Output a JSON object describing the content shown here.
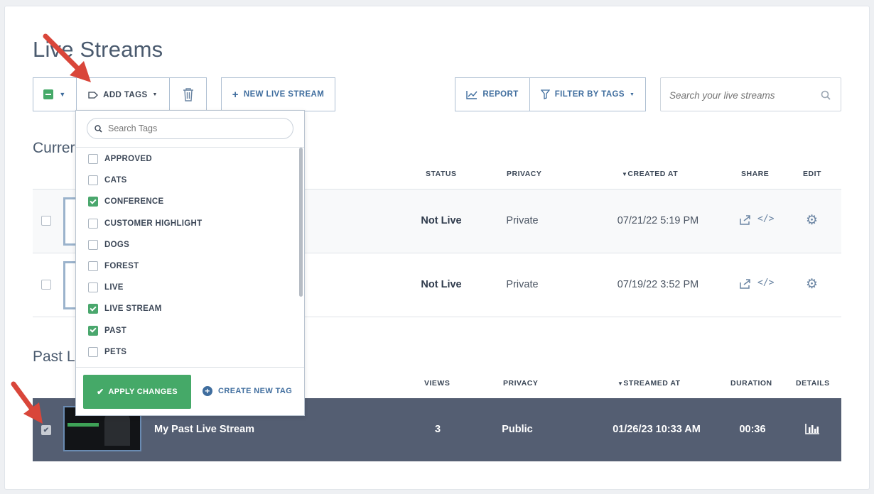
{
  "page_title": "Live Streams",
  "toolbar": {
    "add_tags": "ADD TAGS",
    "new_stream": "NEW LIVE STREAM",
    "report": "REPORT",
    "filter_tags": "FILTER BY TAGS",
    "search_placeholder": "Search your live streams"
  },
  "current": {
    "section_title": "Currer",
    "headers": {
      "status": "STATUS",
      "privacy": "PRIVACY",
      "created": "CREATED AT",
      "share": "SHARE",
      "edit": "EDIT"
    },
    "rows": [
      {
        "status": "Not Live",
        "privacy": "Private",
        "created": "07/21/22 5:19 PM"
      },
      {
        "status": "Not Live",
        "privacy": "Private",
        "created": "07/19/22 3:52 PM"
      }
    ]
  },
  "past": {
    "section_title": "Past Li",
    "headers": {
      "views": "VIEWS",
      "privacy": "PRIVACY",
      "streamed": "STREAMED AT",
      "duration": "DURATION",
      "details": "DETAILS"
    },
    "rows": [
      {
        "name": "My Past Live Stream",
        "views": "3",
        "privacy": "Public",
        "streamed": "01/26/23 10:33 AM",
        "duration": "00:36"
      }
    ]
  },
  "tag_dropdown": {
    "search_placeholder": "Search Tags",
    "tags": [
      {
        "label": "APPROVED",
        "checked": false
      },
      {
        "label": "CATS",
        "checked": false
      },
      {
        "label": "CONFERENCE",
        "checked": true
      },
      {
        "label": "CUSTOMER HIGHLIGHT",
        "checked": false
      },
      {
        "label": "DOGS",
        "checked": false
      },
      {
        "label": "FOREST",
        "checked": false
      },
      {
        "label": "LIVE",
        "checked": false
      },
      {
        "label": "LIVE STREAM",
        "checked": true
      },
      {
        "label": "PAST",
        "checked": true
      },
      {
        "label": "PETS",
        "checked": false
      }
    ],
    "apply_label": "APPLY CHANGES",
    "create_label": "CREATE NEW TAG"
  },
  "colors": {
    "accent": "#3f6d9e",
    "success": "#45a968",
    "annotation_arrow": "#d9463a",
    "selected_row": "#545e72"
  }
}
